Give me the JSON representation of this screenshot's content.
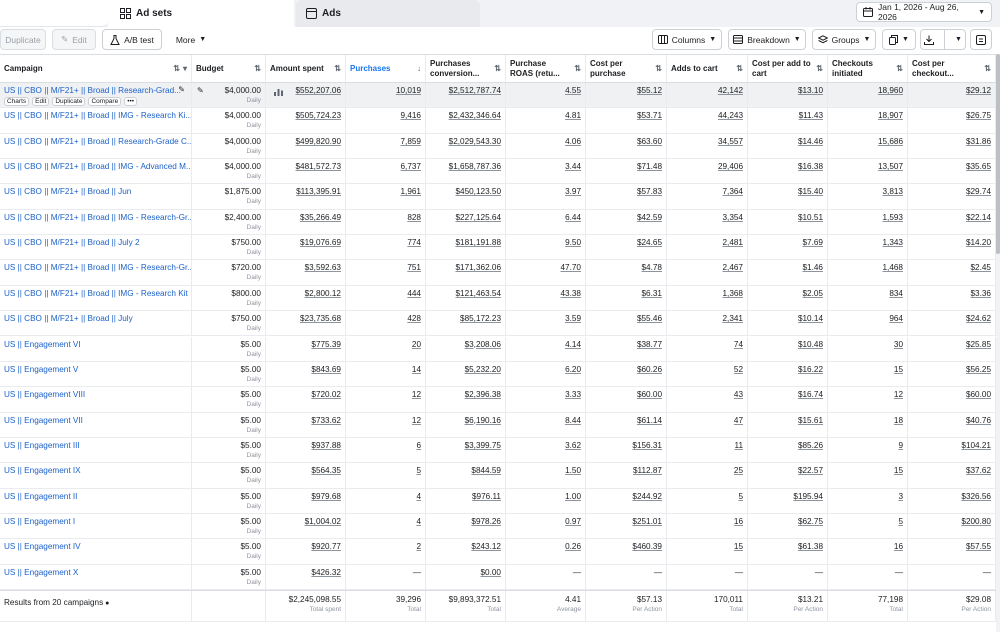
{
  "tabs": [
    {
      "label": ""
    },
    {
      "label": "Ad sets"
    },
    {
      "label": "Ads"
    }
  ],
  "date_range": "Jan 1, 2026 - Aug 26, 2026",
  "toolbar": {
    "duplicate": "Duplicate",
    "edit": "Edit",
    "ab_test": "A/B test",
    "more": "More",
    "columns": "Columns",
    "breakdown": "Breakdown",
    "groups": "Groups"
  },
  "columns": [
    {
      "label": "Campaign",
      "sort": "⇅"
    },
    {
      "label": "Budget",
      "sort": "⇅"
    },
    {
      "label": "Amount spent",
      "sort": "⇅"
    },
    {
      "label": "Purchases",
      "sort": "↓"
    },
    {
      "label": "Purchases conversion...",
      "sort": "⇅"
    },
    {
      "label": "Purchase ROAS (retu...",
      "sort": "⇅"
    },
    {
      "label": "Cost per purchase",
      "sort": "⇅"
    },
    {
      "label": "Adds to cart",
      "sort": "⇅"
    },
    {
      "label": "Cost per add to cart",
      "sort": "⇅"
    },
    {
      "label": "Checkouts initiated",
      "sort": "⇅"
    },
    {
      "label": "Cost per checkout...",
      "sort": "⇅"
    }
  ],
  "row_actions": [
    "Charts",
    "Edit",
    "Duplicate",
    "Compare",
    "•••"
  ],
  "budget_period": "Daily",
  "rows": [
    [
      "US || CBO || M/F21+ || Broad || Research-Grad...",
      "$4,000.00",
      "$552,207.06",
      "10,019",
      "$2,512,787.74",
      "4.55",
      "$55.12",
      "42,142",
      "$13.10",
      "18,960",
      "$29.12"
    ],
    [
      "US || CBO || M/F21+ || Broad || IMG - Research Ki...",
      "$4,000.00",
      "$505,724.23",
      "9,416",
      "$2,432,346.64",
      "4.81",
      "$53.71",
      "44,243",
      "$11.43",
      "18,907",
      "$26.75"
    ],
    [
      "US || CBO || M/F21+ || Broad || Research-Grade C...",
      "$4,000.00",
      "$499,820.90",
      "7,859",
      "$2,029,543.30",
      "4.06",
      "$63.60",
      "34,557",
      "$14.46",
      "15,686",
      "$31.86"
    ],
    [
      "US || CBO || M/F21+ || Broad || IMG - Advanced M...",
      "$4,000.00",
      "$481,572.73",
      "6,737",
      "$1,658,787.36",
      "3.44",
      "$71.48",
      "29,406",
      "$16.38",
      "13,507",
      "$35.65"
    ],
    [
      "US || CBO || M/F21+ || Broad || Jun",
      "$1,875.00",
      "$113,395.91",
      "1,961",
      "$450,123.50",
      "3.97",
      "$57.83",
      "7,364",
      "$15.40",
      "3,813",
      "$29.74"
    ],
    [
      "US || CBO || M/F21+ || Broad || IMG - Research-Gr...",
      "$2,400.00",
      "$35,266.49",
      "828",
      "$227,125.64",
      "6.44",
      "$42.59",
      "3,354",
      "$10.51",
      "1,593",
      "$22.14"
    ],
    [
      "US || CBO || M/F21+ || Broad || July 2",
      "$750.00",
      "$19,076.69",
      "774",
      "$181,191.88",
      "9.50",
      "$24.65",
      "2,481",
      "$7.69",
      "1,343",
      "$14.20"
    ],
    [
      "US || CBO || M/F21+ || Broad || IMG - Research-Gr...",
      "$720.00",
      "$3,592.63",
      "751",
      "$171,362.06",
      "47.70",
      "$4.78",
      "2,467",
      "$1.46",
      "1,468",
      "$2.45"
    ],
    [
      "US || CBO || M/F21+ || Broad || IMG - Research Kit",
      "$800.00",
      "$2,800.12",
      "444",
      "$121,463.54",
      "43.38",
      "$6.31",
      "1,368",
      "$2.05",
      "834",
      "$3.36"
    ],
    [
      "US || CBO || M/F21+ || Broad || July",
      "$750.00",
      "$23,735.68",
      "428",
      "$85,172.23",
      "3.59",
      "$55.46",
      "2,341",
      "$10.14",
      "964",
      "$24.62"
    ],
    [
      "US || Engagement VI",
      "$5.00",
      "$775.39",
      "20",
      "$3,208.06",
      "4.14",
      "$38.77",
      "74",
      "$10.48",
      "30",
      "$25.85"
    ],
    [
      "US || Engagement V",
      "$5.00",
      "$843.69",
      "14",
      "$5,232.20",
      "6.20",
      "$60.26",
      "52",
      "$16.22",
      "15",
      "$56.25"
    ],
    [
      "US || Engagement VIII",
      "$5.00",
      "$720.02",
      "12",
      "$2,396.38",
      "3.33",
      "$60.00",
      "43",
      "$16.74",
      "12",
      "$60.00"
    ],
    [
      "US || Engagement VII",
      "$5.00",
      "$733.62",
      "12",
      "$6,190.16",
      "8.44",
      "$61.14",
      "47",
      "$15.61",
      "18",
      "$40.76"
    ],
    [
      "US || Engagement III",
      "$5.00",
      "$937.88",
      "6",
      "$3,399.75",
      "3.62",
      "$156.31",
      "11",
      "$85.26",
      "9",
      "$104.21"
    ],
    [
      "US || Engagement IX",
      "$5.00",
      "$564.35",
      "5",
      "$844.59",
      "1.50",
      "$112.87",
      "25",
      "$22.57",
      "15",
      "$37.62"
    ],
    [
      "US || Engagement II",
      "$5.00",
      "$979.68",
      "4",
      "$976.11",
      "1.00",
      "$244.92",
      "5",
      "$195.94",
      "3",
      "$326.56"
    ],
    [
      "US || Engagement I",
      "$5.00",
      "$1,004.02",
      "4",
      "$978.26",
      "0.97",
      "$251.01",
      "16",
      "$62.75",
      "5",
      "$200.80"
    ],
    [
      "US || Engagement IV",
      "$5.00",
      "$920.77",
      "2",
      "$243.12",
      "0.26",
      "$460.39",
      "15",
      "$61.38",
      "16",
      "$57.55"
    ],
    [
      "US || Engagement X",
      "$5.00",
      "$426.32",
      "—",
      "$0.00",
      "—",
      "—",
      "—",
      "—",
      "—",
      "—"
    ]
  ],
  "footer": {
    "label": "Results from 20 campaigns",
    "values": [
      "",
      "$2,245,098.55",
      "39,296",
      "$9,893,372.51",
      "4.41",
      "$57.13",
      "170,011",
      "$13.21",
      "77,198",
      "$29.08"
    ],
    "subs": [
      "",
      "Total spent",
      "Total",
      "Total",
      "Average",
      "Per Action",
      "Total",
      "Per Action",
      "Total",
      "Per Action"
    ]
  },
  "colors": {
    "link": "#1b61c9",
    "accent": "#1877f2"
  }
}
